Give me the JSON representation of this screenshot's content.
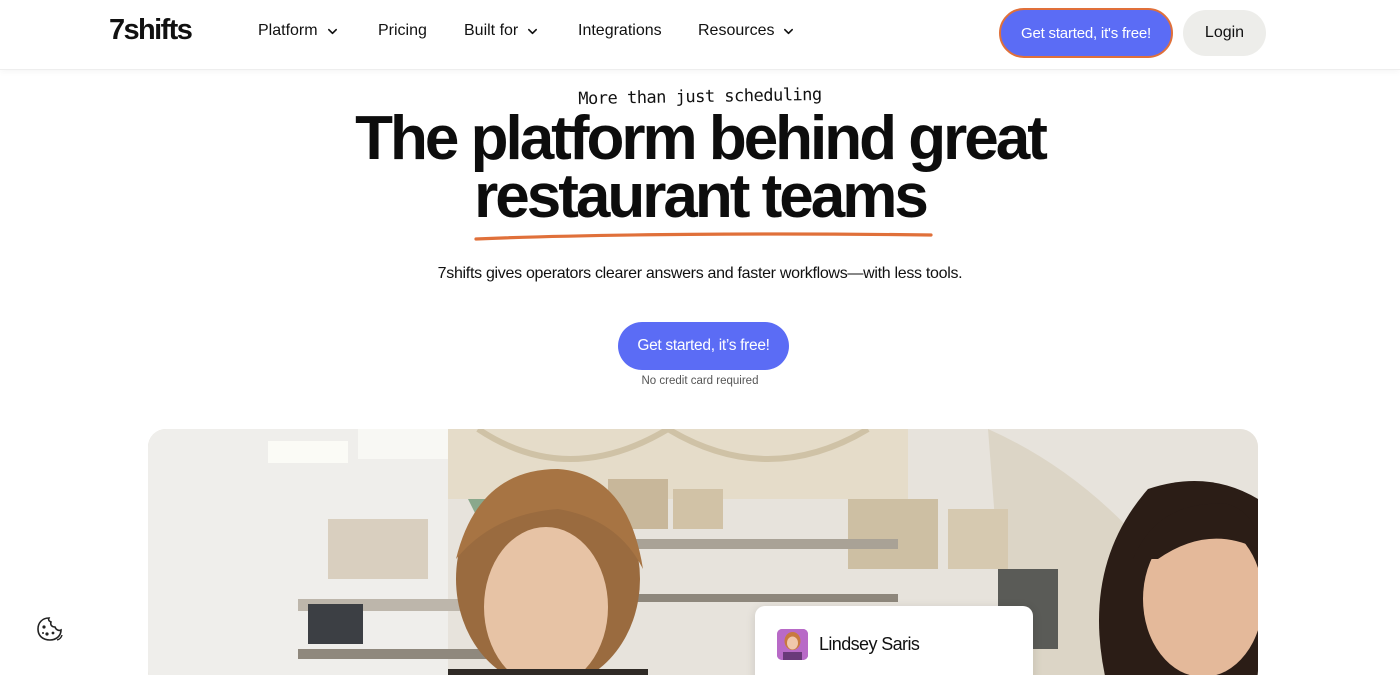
{
  "header": {
    "logo": "7shifts",
    "nav": [
      {
        "label": "Platform",
        "has_dropdown": true
      },
      {
        "label": "Pricing",
        "has_dropdown": false
      },
      {
        "label": "Built for",
        "has_dropdown": true
      },
      {
        "label": "Integrations",
        "has_dropdown": false
      },
      {
        "label": "Resources",
        "has_dropdown": true
      }
    ],
    "cta_label": "Get started, it's free!",
    "login_label": "Login"
  },
  "hero": {
    "eyebrow": "More than just scheduling",
    "headline_line1": "The platform behind great",
    "headline_line2": "restaurant teams",
    "subtitle": "7shifts gives operators clearer answers and faster workflows—with less tools.",
    "cta_label": "Get started, it’s free!",
    "note": "No credit card required"
  },
  "testimonial": {
    "name": "Lindsey Saris"
  },
  "icons": {
    "dropdown": "chevron-down-icon",
    "cookie": "cookie-icon"
  },
  "colors": {
    "primary": "#5b6cf5",
    "accent_orange": "#e0703a",
    "login_bg": "#ededea"
  }
}
